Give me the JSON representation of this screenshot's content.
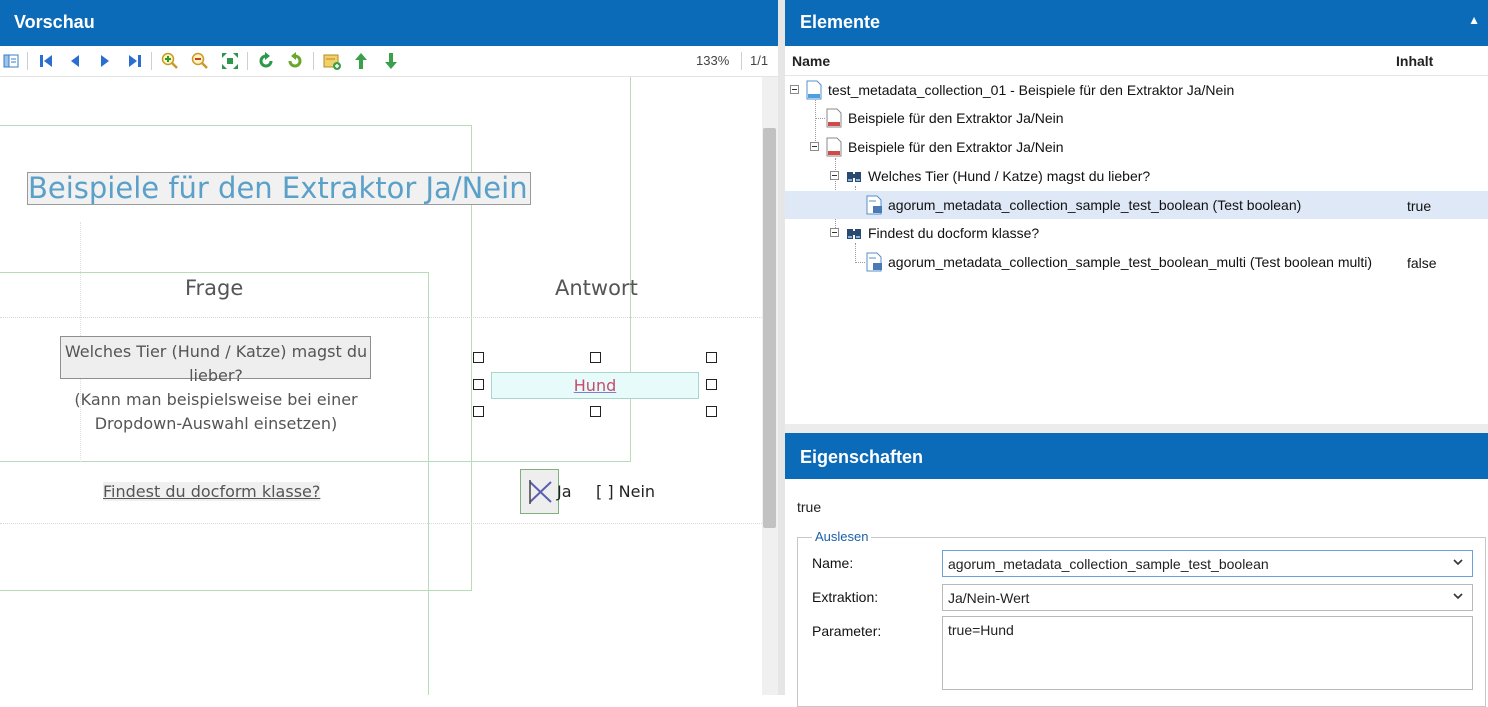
{
  "preview": {
    "title": "Vorschau",
    "toolbar": {
      "zoom": "133%",
      "pages": "1/1",
      "icons": [
        "layout-icon",
        "first-page-icon",
        "prev-page-icon",
        "next-page-icon",
        "last-page-icon",
        "zoom-in-icon",
        "zoom-out-icon",
        "fit-page-icon",
        "rotate-left-icon",
        "rotate-right-icon",
        "add-field-icon",
        "move-up-icon",
        "move-down-icon"
      ]
    },
    "document": {
      "title": "Beispiele für den Extraktor Ja/Nein",
      "col_frage": "Frage",
      "col_antwort": "Antwort",
      "question1_line1": "Welches Tier (Hund / Katze) magst du",
      "question1_line2": "lieber?",
      "question1_hint_line1": "(Kann man beispielsweise bei einer",
      "question1_hint_line2": "Dropdown-Auswahl einsetzen)",
      "answer1": "Hund",
      "question2": "Findest du docform klasse?",
      "answer2_yes": "Ja",
      "answer2_no": "[ ] Nein"
    }
  },
  "elements": {
    "title": "Elemente",
    "col_name": "Name",
    "col_content": "Inhalt",
    "tree": [
      {
        "label": "test_metadata_collection_01 - Beispiele für den Extraktor Ja/Nein",
        "value": ""
      },
      {
        "label": "Beispiele für den Extraktor Ja/Nein",
        "value": ""
      },
      {
        "label": "Beispiele für den Extraktor Ja/Nein",
        "value": ""
      },
      {
        "label": "Welches Tier (Hund / Katze) magst du lieber?",
        "value": ""
      },
      {
        "label": "agorum_metadata_collection_sample_test_boolean (Test boolean)",
        "value": "true"
      },
      {
        "label": "Findest du docform klasse?",
        "value": ""
      },
      {
        "label": "agorum_metadata_collection_sample_test_boolean_multi (Test boolean multi)",
        "value": "false"
      }
    ]
  },
  "properties": {
    "title": "Eigenschaften",
    "value": "true",
    "group_label": "Auslesen",
    "name_label": "Name:",
    "name_value": "agorum_metadata_collection_sample_test_boolean",
    "extraction_label": "Extraktion:",
    "extraction_value": "Ja/Nein-Wert",
    "parameter_label": "Parameter:",
    "parameter_value": "true=Hund"
  },
  "colors": {
    "header_blue": "#0b6bb8",
    "selected_row": "#dfe8f6",
    "legend_blue": "#1b62a8"
  }
}
